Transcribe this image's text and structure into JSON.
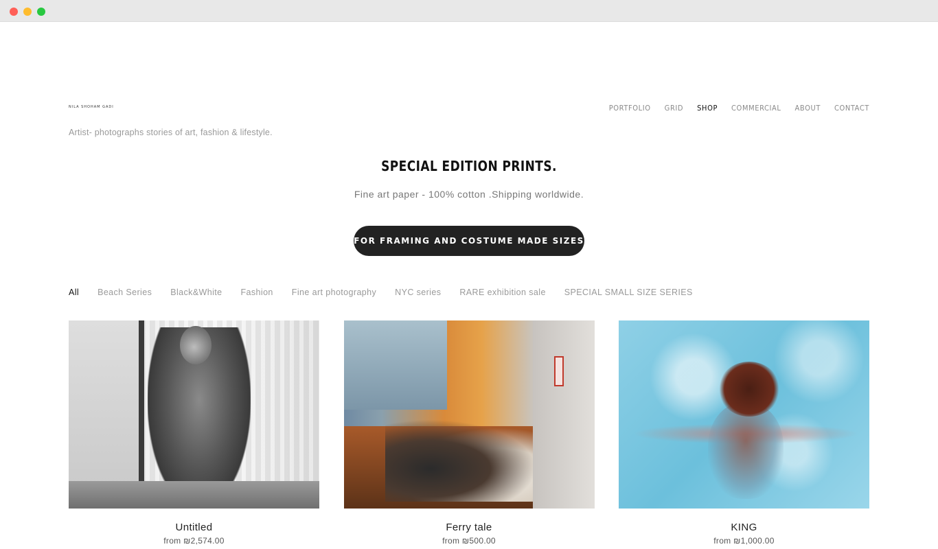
{
  "site": {
    "logo_text": "NILA SHOHAM GADI",
    "tagline": "Artist- photographs stories of art, fashion & lifestyle."
  },
  "nav": {
    "items": [
      {
        "label": "PORTFOLIO",
        "active": false
      },
      {
        "label": "GRID",
        "active": false
      },
      {
        "label": "SHOP",
        "active": true
      },
      {
        "label": "COMMERCIAL",
        "active": false
      },
      {
        "label": "ABOUT",
        "active": false
      },
      {
        "label": "CONTACT",
        "active": false
      }
    ]
  },
  "hero": {
    "title": "SPECIAL EDITION  PRINTS.",
    "subtitle": "Fine art paper - 100% cotton .Shipping worldwide.",
    "cta_label": "FOR FRAMING AND COSTUME MADE SIZES"
  },
  "filters": {
    "items": [
      {
        "label": "All",
        "active": true
      },
      {
        "label": "Beach Series",
        "active": false
      },
      {
        "label": "Black&White",
        "active": false
      },
      {
        "label": "Fashion",
        "active": false
      },
      {
        "label": "Fine art photography",
        "active": false
      },
      {
        "label": "NYC series",
        "active": false
      },
      {
        "label": "RARE exhibition sale",
        "active": false
      },
      {
        "label": "SPECIAL SMALL SIZE SERIES",
        "active": false
      }
    ]
  },
  "products": [
    {
      "title": "Untitled",
      "price": "from ₪2,574.00"
    },
    {
      "title": "Ferry tale",
      "price": "from ₪500.00"
    },
    {
      "title": "KING",
      "price": "from ₪1,000.00"
    }
  ],
  "colors": {
    "cta_background": "#222222",
    "nav_active": "#111111",
    "nav_inactive": "#8a8a8a"
  }
}
